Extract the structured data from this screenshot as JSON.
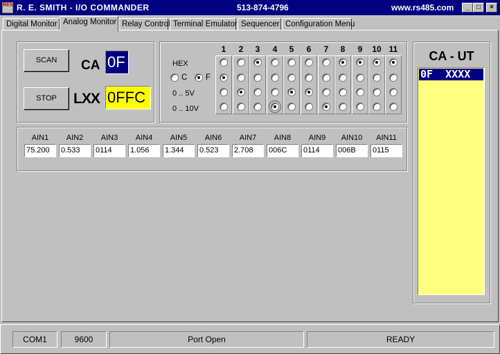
{
  "window": {
    "title": "R. E. SMITH  -  I/O COMMANDER",
    "phone": "513-874-4796",
    "website": "www.rs485.com",
    "icon_text": "RES",
    "controls": {
      "minimize": "_",
      "maximize": "□",
      "close": "×"
    }
  },
  "tabs": [
    {
      "label": "Digital Monitor",
      "active": false
    },
    {
      "label": "Analog Monitor",
      "active": true
    },
    {
      "label": "Relay Control",
      "active": false
    },
    {
      "label": "Terminal Emulator",
      "active": false
    },
    {
      "label": "Sequencer",
      "active": false
    },
    {
      "label": "Configuration Menu",
      "active": false
    }
  ],
  "controls": {
    "scan_label": "SCAN",
    "stop_label": "STOP",
    "ca_label": "CA",
    "ca_value": "0F",
    "lxx_label": "LXX",
    "lxx_value": "0FFC"
  },
  "grid": {
    "columns": [
      "1",
      "2",
      "3",
      "4",
      "5",
      "6",
      "7",
      "8",
      "9",
      "10",
      "11"
    ],
    "hex_label": "HEX",
    "c_label": "C",
    "f_label": "F",
    "cf_selected": "F",
    "row_labels": [
      "0 .. 5V",
      "0 .. 10V"
    ],
    "selection": {
      "hex": [
        false,
        false,
        true,
        false,
        false,
        false,
        false,
        true,
        true,
        true,
        true
      ],
      "f": [
        true,
        false,
        false,
        false,
        false,
        false,
        false,
        false,
        false,
        false,
        false
      ],
      "v5": [
        false,
        true,
        false,
        false,
        true,
        true,
        false,
        false,
        false,
        false,
        false
      ],
      "v10": [
        false,
        false,
        false,
        true,
        false,
        false,
        true,
        false,
        false,
        false,
        false
      ]
    },
    "focus": {
      "row": "v10",
      "col": 4
    }
  },
  "ain": {
    "labels": [
      "AIN1",
      "AIN2",
      "AIN3",
      "AIN4",
      "AIN5",
      "AIN6",
      "AIN7",
      "AIN8",
      "AIN9",
      "AIN10",
      "AIN11"
    ],
    "values": [
      "75.200",
      "0.533",
      "0114",
      "1.056",
      "1.344",
      "0.523",
      "2.708",
      "006C",
      "0114",
      "006B",
      "0115"
    ]
  },
  "caut": {
    "title": "CA - UT",
    "items": [
      "0F  XXXX"
    ]
  },
  "status": {
    "port": "COM1",
    "baud": "9600",
    "port_state": "Port Open",
    "state": "READY"
  }
}
